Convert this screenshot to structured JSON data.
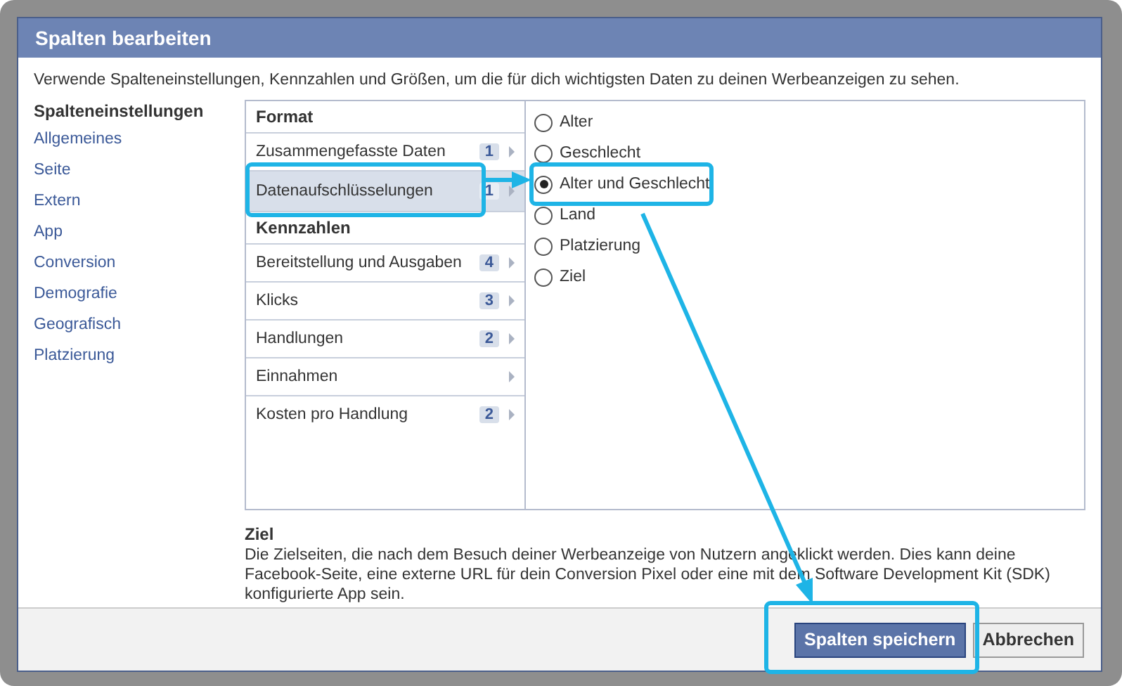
{
  "dialog": {
    "title": "Spalten bearbeiten",
    "intro": "Verwende Spalteneinstellungen, Kennzahlen und Größen, um die für dich wichtigsten Daten zu deinen Werbeanzeigen zu sehen.",
    "sidebar": {
      "heading": "Spalteneinstellungen",
      "items": [
        {
          "label": "Allgemeines"
        },
        {
          "label": "Seite"
        },
        {
          "label": "Extern"
        },
        {
          "label": "App"
        },
        {
          "label": "Conversion"
        },
        {
          "label": "Demografie"
        },
        {
          "label": "Geografisch"
        },
        {
          "label": "Platzierung"
        }
      ]
    },
    "sections": [
      {
        "heading": "Format",
        "items": [
          {
            "label": "Zusammengefasste Daten",
            "count": "1",
            "selected": false
          },
          {
            "label": "Datenaufschlüsselungen",
            "count": "1",
            "selected": true
          }
        ]
      },
      {
        "heading": "Kennzahlen",
        "items": [
          {
            "label": "Bereitstellung und Ausgaben",
            "count": "4",
            "selected": false
          },
          {
            "label": "Klicks",
            "count": "3",
            "selected": false
          },
          {
            "label": "Handlungen",
            "count": "2",
            "selected": false
          },
          {
            "label": "Einnahmen",
            "selected": false
          },
          {
            "label": "Kosten pro Handlung",
            "count": "2",
            "selected": false
          }
        ]
      }
    ],
    "options": [
      {
        "label": "Alter",
        "selected": false
      },
      {
        "label": "Geschlecht",
        "selected": false
      },
      {
        "label": "Alter und Geschlecht",
        "selected": true
      },
      {
        "label": "Land",
        "selected": false
      },
      {
        "label": "Platzierung",
        "selected": false
      },
      {
        "label": "Ziel",
        "selected": false
      }
    ],
    "detail": {
      "heading": "Ziel",
      "text": "Die Zielseiten, die nach dem Besuch deiner Werbeanzeige von Nutzern angeklickt werden. Dies kann deine Facebook-Seite, eine externe URL für dein Conversion Pixel oder eine mit dem Software Development Kit (SDK) konfigurierte App sein."
    },
    "buttons": [
      {
        "label": "Spalten speichern",
        "kind": "primary"
      },
      {
        "label": "Abbrechen",
        "kind": "secondary"
      }
    ]
  }
}
